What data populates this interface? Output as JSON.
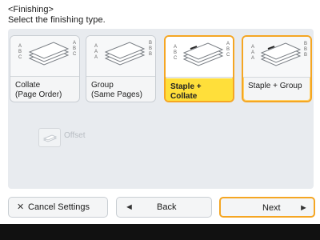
{
  "header": {
    "section": "<Finishing>",
    "instruction": "Select the finishing type."
  },
  "tiles": [
    {
      "label_line1": "Collate",
      "label_line2": "(Page Order)"
    },
    {
      "label_line1": "Group",
      "label_line2": "(Same Pages)"
    },
    {
      "label_line1": "Staple + Collate",
      "label_line2": ""
    },
    {
      "label_line1": "Staple + Group",
      "label_line2": ""
    }
  ],
  "offset": {
    "label": "Offset"
  },
  "buttons": {
    "cancel": {
      "label": "Cancel Settings",
      "icon": "x-icon"
    },
    "back": {
      "label": "Back",
      "icon": "left-arrow-icon"
    },
    "next": {
      "label": "Next",
      "icon": "right-arrow-icon"
    }
  },
  "colors": {
    "selected_border": "#f5a623",
    "selected_fill": "#ffdf3a",
    "panel_bg": "#e8ebef"
  }
}
